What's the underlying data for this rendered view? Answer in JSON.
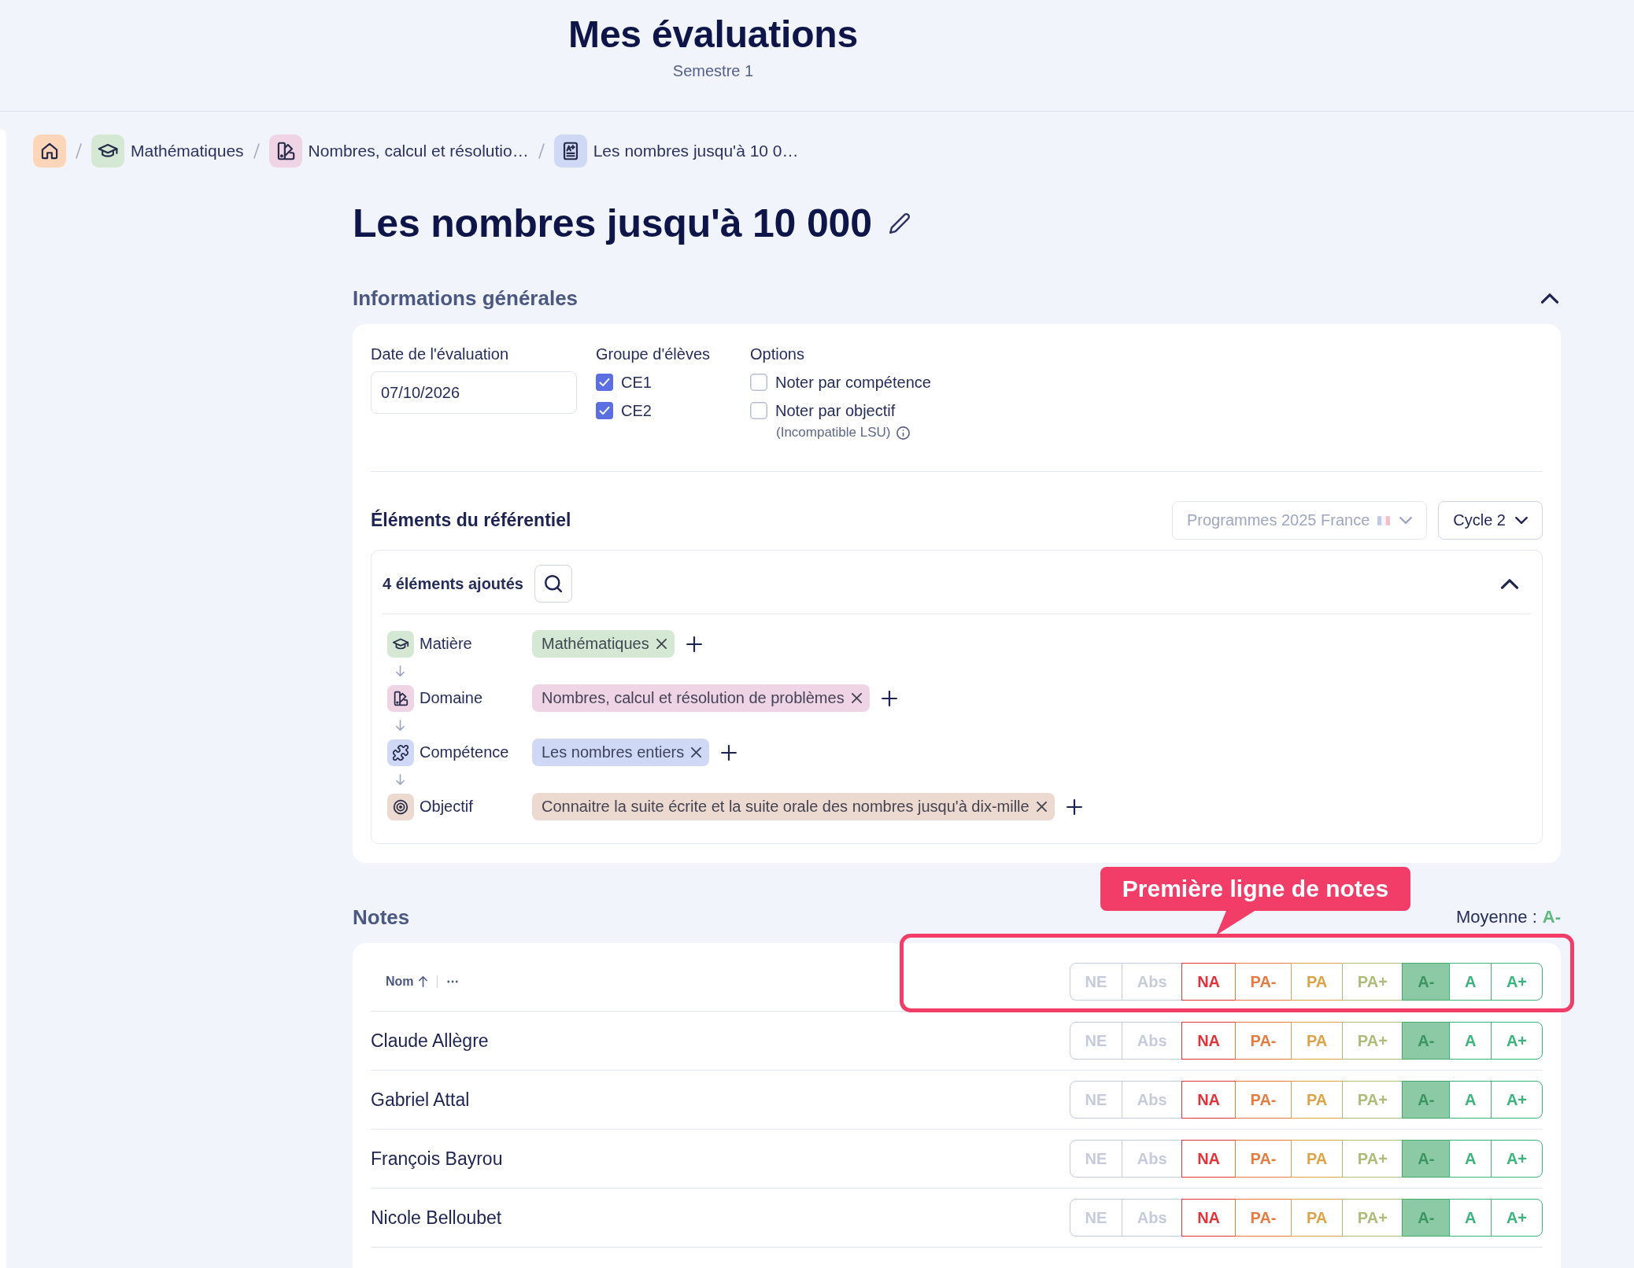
{
  "header": {
    "title": "Mes évaluations",
    "subtitle": "Semestre 1"
  },
  "breadcrumb": [
    {
      "kind": "home",
      "color": "#fdd5b9"
    },
    {
      "kind": "subject",
      "color": "#d5e8d3",
      "label": "Mathématiques"
    },
    {
      "kind": "domain",
      "color": "#eed4e5",
      "label": "Nombres, calcul et résolutio…"
    },
    {
      "kind": "document",
      "color": "#cfd9f6",
      "label": "Les nombres jusqu'à 10 0…"
    }
  ],
  "page_title": "Les nombres jusqu'à 10 000",
  "general_info": {
    "title": "Informations générales",
    "expanded": true,
    "date": {
      "label": "Date de l'évaluation",
      "value": "07/10/2026"
    },
    "groups": {
      "label": "Groupe d'élèves",
      "items": [
        {
          "label": "CE1",
          "checked": true
        },
        {
          "label": "CE2",
          "checked": true
        }
      ]
    },
    "options": {
      "label": "Options",
      "items": [
        {
          "label": "Noter par compétence",
          "checked": false
        },
        {
          "label": "Noter par objectif",
          "checked": false,
          "note": "(Incompatible LSU)"
        }
      ]
    },
    "referential": {
      "title": "Éléments du référentiel",
      "program": {
        "label": "Programmes 2025 France",
        "disabled": true
      },
      "cycle": {
        "label": "Cycle 2",
        "disabled": false
      },
      "added": {
        "title": "4 éléments ajoutés",
        "expanded": true
      },
      "levels": [
        {
          "kind": "subject",
          "label": "Matière",
          "color": "#d5e8d3",
          "tag": "Mathématiques"
        },
        {
          "kind": "domain",
          "label": "Domaine",
          "color": "#eed4e5",
          "tag": "Nombres, calcul et résolution de problèmes"
        },
        {
          "kind": "competence",
          "label": "Compétence",
          "color": "#cfd9f6",
          "tag": "Les nombres entiers"
        },
        {
          "kind": "objective",
          "label": "Objectif",
          "color": "#ecdad0",
          "tag": "Connaitre la suite écrite et la suite orale des nombres jusqu'à dix-mille"
        }
      ]
    }
  },
  "notes": {
    "title": "Notes",
    "average_label": "Moyenne :",
    "average": "A-",
    "annotation": "Première ligne de notes",
    "name_column": "Nom",
    "header_grades": [
      {
        "label": "NE",
        "color": "#c5cbdb",
        "selected": false
      },
      {
        "label": "Abs",
        "color": "#c5cbdb",
        "selected": false
      },
      {
        "label": "NA",
        "color": "#e2323a",
        "selected": false
      },
      {
        "label": "PA-",
        "color": "#e37b43",
        "selected": false
      },
      {
        "label": "PA",
        "color": "#dca447",
        "selected": false
      },
      {
        "label": "PA+",
        "color": "#aebb79",
        "selected": false
      },
      {
        "label": "A-",
        "color": "#45a86e",
        "selected": true
      },
      {
        "label": "A",
        "color": "#3bb57a",
        "selected": false
      },
      {
        "label": "A+",
        "color": "#3bb57a",
        "selected": false
      }
    ],
    "rows": [
      {
        "name": "Claude Allègre",
        "grades": [
          {
            "label": "NE",
            "color": "#c5cbdb",
            "selected": false
          },
          {
            "label": "Abs",
            "color": "#c5cbdb",
            "selected": false
          },
          {
            "label": "NA",
            "color": "#e2323a",
            "selected": false
          },
          {
            "label": "PA-",
            "color": "#e37b43",
            "selected": false
          },
          {
            "label": "PA",
            "color": "#dca447",
            "selected": false
          },
          {
            "label": "PA+",
            "color": "#aebb79",
            "selected": false
          },
          {
            "label": "A-",
            "color": "#45a86e",
            "selected": true
          },
          {
            "label": "A",
            "color": "#3bb57a",
            "selected": false
          },
          {
            "label": "A+",
            "color": "#3bb57a",
            "selected": false
          }
        ]
      },
      {
        "name": "Gabriel Attal",
        "grades": [
          {
            "label": "NE",
            "color": "#c5cbdb",
            "selected": false
          },
          {
            "label": "Abs",
            "color": "#c5cbdb",
            "selected": false
          },
          {
            "label": "NA",
            "color": "#e2323a",
            "selected": false
          },
          {
            "label": "PA-",
            "color": "#e37b43",
            "selected": false
          },
          {
            "label": "PA",
            "color": "#dca447",
            "selected": false
          },
          {
            "label": "PA+",
            "color": "#aebb79",
            "selected": false
          },
          {
            "label": "A-",
            "color": "#45a86e",
            "selected": true
          },
          {
            "label": "A",
            "color": "#3bb57a",
            "selected": false
          },
          {
            "label": "A+",
            "color": "#3bb57a",
            "selected": false
          }
        ]
      },
      {
        "name": "François Bayrou",
        "grades": [
          {
            "label": "NE",
            "color": "#c5cbdb",
            "selected": false
          },
          {
            "label": "Abs",
            "color": "#c5cbdb",
            "selected": false
          },
          {
            "label": "NA",
            "color": "#e2323a",
            "selected": false
          },
          {
            "label": "PA-",
            "color": "#e37b43",
            "selected": false
          },
          {
            "label": "PA",
            "color": "#dca447",
            "selected": false
          },
          {
            "label": "PA+",
            "color": "#aebb79",
            "selected": false
          },
          {
            "label": "A-",
            "color": "#45a86e",
            "selected": true
          },
          {
            "label": "A",
            "color": "#3bb57a",
            "selected": false
          },
          {
            "label": "A+",
            "color": "#3bb57a",
            "selected": false
          }
        ]
      },
      {
        "name": "Nicole Belloubet",
        "grades": [
          {
            "label": "NE",
            "color": "#c5cbdb",
            "selected": false
          },
          {
            "label": "Abs",
            "color": "#c5cbdb",
            "selected": false
          },
          {
            "label": "NA",
            "color": "#e2323a",
            "selected": false
          },
          {
            "label": "PA-",
            "color": "#e37b43",
            "selected": false
          },
          {
            "label": "PA",
            "color": "#dca447",
            "selected": false
          },
          {
            "label": "PA+",
            "color": "#aebb79",
            "selected": false
          },
          {
            "label": "A-",
            "color": "#45a86e",
            "selected": true
          },
          {
            "label": "A",
            "color": "#3bb57a",
            "selected": false
          },
          {
            "label": "A+",
            "color": "#3bb57a",
            "selected": false
          }
        ]
      }
    ]
  }
}
